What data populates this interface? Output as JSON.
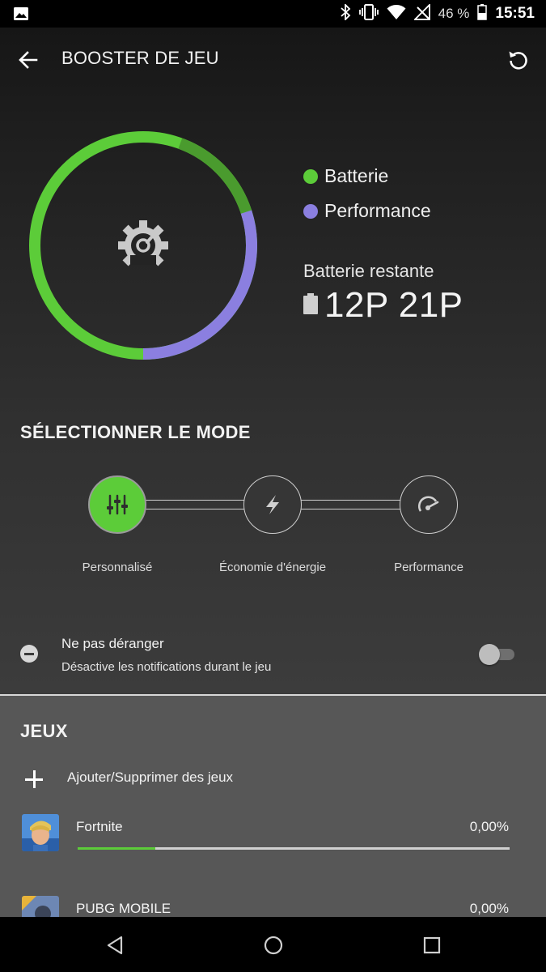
{
  "statusbar": {
    "battery_percent": "46 %",
    "time": "15:51",
    "icons": [
      "image-icon",
      "bluetooth-icon",
      "vibrate-icon",
      "wifi-icon",
      "no-signal-icon",
      "battery-icon"
    ]
  },
  "appbar": {
    "title": "BOOSTER DE JEU",
    "back_icon": "arrow-left-icon",
    "refresh_icon": "refresh-icon"
  },
  "usage": {
    "battery_fraction": 0.7,
    "performance_fraction": 0.3,
    "center_icon": "gear-speedometer-icon",
    "legend": [
      {
        "label": "Batterie",
        "color": "#5ccc39"
      },
      {
        "label": "Performance",
        "color": "#8b7fe0"
      }
    ],
    "battery_remaining_label": "Batterie restante",
    "battery_remaining_value": "12P 21P"
  },
  "mode": {
    "title": "SÉLECTIONNER LE MODE",
    "options": [
      {
        "label": "Personnalisé",
        "selected": true,
        "icon": "sliders-icon"
      },
      {
        "label": "Économie d'énergie",
        "selected": false,
        "icon": "lightning-icon"
      },
      {
        "label": "Performance",
        "selected": false,
        "icon": "speedometer-icon"
      }
    ]
  },
  "dnd": {
    "title": "Ne pas déranger",
    "subtitle": "Désactive les notifications durant le jeu",
    "enabled": false,
    "icon": "minus-circle-icon"
  },
  "games": {
    "title": "JEUX",
    "add_label": "Ajouter/Supprimer des jeux",
    "items": [
      {
        "name": "Fortnite",
        "percent": "0,00%",
        "bar_fraction": 0.18
      },
      {
        "name": "PUBG MOBILE",
        "percent": "0,00%",
        "bar_fraction": 0
      }
    ]
  },
  "navbar": {
    "icons": [
      "back-triangle-icon",
      "home-circle-icon",
      "recents-square-icon"
    ]
  },
  "colors": {
    "accent_green": "#5ccc39",
    "accent_purple": "#8b7fe0"
  }
}
